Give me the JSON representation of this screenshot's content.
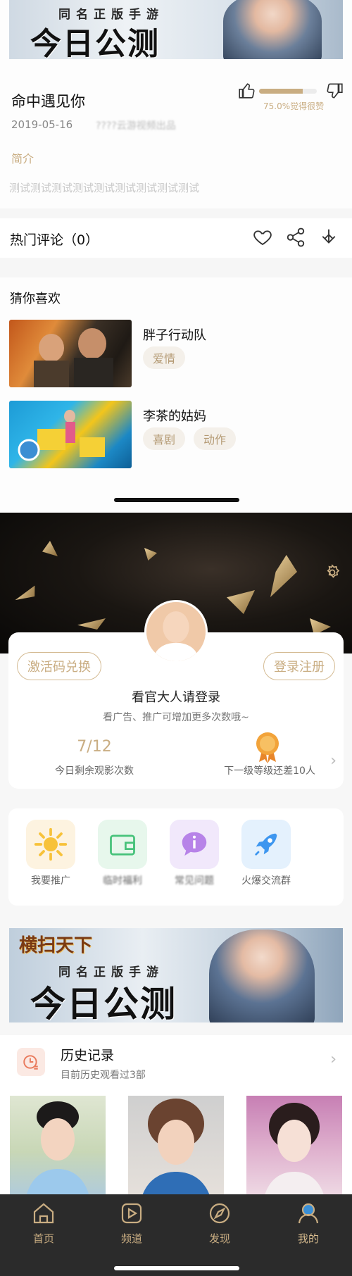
{
  "detail": {
    "banner": {
      "subtitle": "同名正版手游",
      "title": "今日公测"
    },
    "title": "命中遇见你",
    "date": "2019-05-16",
    "date_extra": "????云游视频出品",
    "rating_text": "75.0%觉得很赞",
    "rating_fraction": 0.75,
    "intro_label": "简介",
    "intro_text": "测试测试测试测试测试测试测试测试测试",
    "comments_title": "热门评论（0）",
    "guess_title": "猜你喜欢",
    "recommendations": [
      {
        "name": "胖子行动队",
        "tags": [
          "爱情"
        ]
      },
      {
        "name": "李茶的姑妈",
        "tags": [
          "喜剧",
          "动作"
        ]
      }
    ]
  },
  "profile": {
    "activate_label": "激活码兑换",
    "login_button_label": "登录注册",
    "login_title": "看官大人请登录",
    "login_sub": "看广告、推广可增加更多次数哦~",
    "remaining_count": "7/12",
    "remaining_label": "今日剩余观影次数",
    "level_label": "下一级等级还差10人",
    "features": [
      {
        "label": "我要推广",
        "icon": "sun-icon"
      },
      {
        "label": "临时福利",
        "icon": "wallet-icon"
      },
      {
        "label": "常见问题",
        "icon": "info-icon"
      },
      {
        "label": "火爆交流群",
        "icon": "rocket-icon"
      }
    ],
    "banner": {
      "top_text": "横扫天下",
      "subtitle": "同名正版手游",
      "title": "今日公测"
    },
    "history_title": "历史记录",
    "history_sub": "目前历史观看过3部"
  },
  "tabbar": [
    {
      "label": "首页",
      "icon": "home-icon"
    },
    {
      "label": "频道",
      "icon": "play-icon"
    },
    {
      "label": "发现",
      "icon": "compass-icon"
    },
    {
      "label": "我的",
      "icon": "user-icon"
    }
  ],
  "colors": {
    "accent": "#c9ad82",
    "tabbar_bg": "#2b2b2b",
    "header_bg": "#0b0908"
  }
}
